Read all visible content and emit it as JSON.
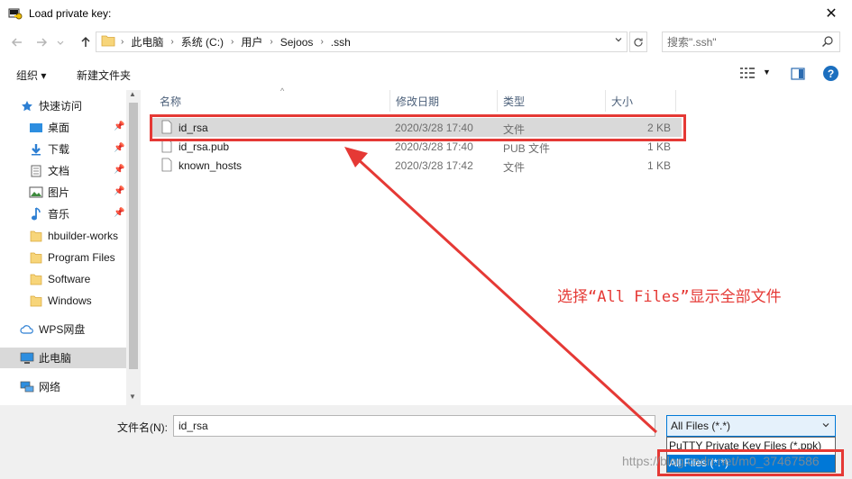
{
  "window": {
    "title": "Load private key:",
    "close_glyph": "✕",
    "icon": "putty-key-icon"
  },
  "address": {
    "breadcrumbs": [
      "此电脑",
      "系统 (C:)",
      "用户",
      "Sejoos",
      ".ssh"
    ],
    "search_placeholder": "搜索\".ssh\""
  },
  "toolbar": {
    "organize_label": "组织 ▾",
    "new_folder_label": "新建文件夹"
  },
  "nav": {
    "items": [
      {
        "label": "快速访问",
        "icon": "star-icon",
        "pinned": false
      },
      {
        "label": "桌面",
        "icon": "desktop-icon",
        "pinned": true
      },
      {
        "label": "下载",
        "icon": "download-icon",
        "pinned": true
      },
      {
        "label": "文档",
        "icon": "document-icon",
        "pinned": true
      },
      {
        "label": "图片",
        "icon": "picture-icon",
        "pinned": true
      },
      {
        "label": "音乐",
        "icon": "music-icon",
        "pinned": true
      },
      {
        "label": "hbuilder-works",
        "icon": "folder-icon",
        "pinned": false
      },
      {
        "label": "Program Files",
        "icon": "folder-icon",
        "pinned": false
      },
      {
        "label": "Software",
        "icon": "folder-icon",
        "pinned": false
      },
      {
        "label": "Windows",
        "icon": "folder-icon",
        "pinned": false
      },
      {
        "label": "WPS网盘",
        "icon": "cloud-icon",
        "pinned": false
      },
      {
        "label": "此电脑",
        "icon": "computer-icon",
        "pinned": false,
        "selected": true
      },
      {
        "label": "网络",
        "icon": "network-icon",
        "pinned": false
      }
    ]
  },
  "filelist": {
    "headers": [
      "名称",
      "修改日期",
      "类型",
      "大小"
    ],
    "rows": [
      {
        "name": "id_rsa",
        "date": "2020/3/28 17:40",
        "type": "文件",
        "size": "2 KB",
        "selected": true
      },
      {
        "name": "id_rsa.pub",
        "date": "2020/3/28 17:40",
        "type": "PUB 文件",
        "size": "1 KB"
      },
      {
        "name": "known_hosts",
        "date": "2020/3/28 17:42",
        "type": "文件",
        "size": "1 KB"
      }
    ]
  },
  "bottom": {
    "filename_label": "文件名(N):",
    "filename_value": "id_rsa",
    "filetype_selected": "All Files (*.*)",
    "filetype_options": [
      "PuTTY Private Key Files (*.ppk)",
      "All Files (*.*)"
    ]
  },
  "annotation": {
    "text": "选择“All Files”显示全部文件",
    "color": "#e53935"
  },
  "watermark": "https://blog.csdn.net/m0_37467586"
}
